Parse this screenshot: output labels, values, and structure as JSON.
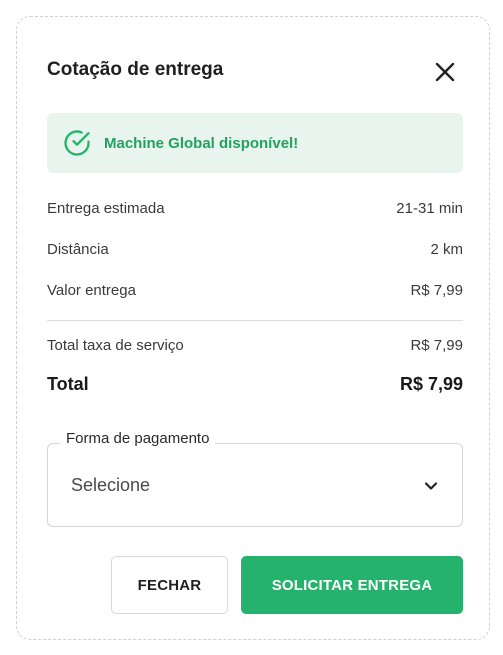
{
  "dialog": {
    "title": "Cotação de entrega"
  },
  "alert": {
    "message": "Machine Global disponível!",
    "color": "#25b26d"
  },
  "details": [
    {
      "label": "Entrega estimada",
      "value": "21-31 min"
    },
    {
      "label": "Distância",
      "value": "2 km"
    },
    {
      "label": "Valor entrega",
      "value": "R$ 7,99"
    }
  ],
  "fees": {
    "label": "Total taxa de serviço",
    "value": "R$ 7,99"
  },
  "total": {
    "label": "Total",
    "value": "R$ 7,99"
  },
  "payment": {
    "legend": "Forma de pagamento",
    "selected": "Selecione"
  },
  "actions": {
    "close_label": "FECHAR",
    "submit_label": "SOLICITAR ENTREGA"
  },
  "colors": {
    "primary": "#25b26d",
    "alert_bg": "#e7f5ee"
  }
}
